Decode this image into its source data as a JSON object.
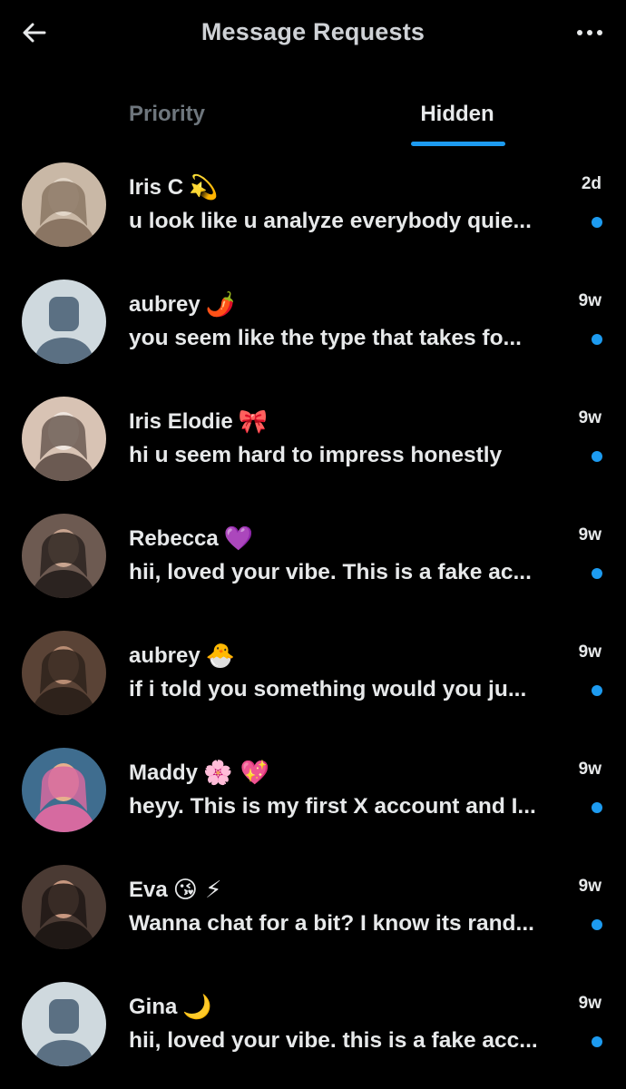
{
  "header": {
    "title": "Message Requests",
    "back_icon": "arrow-left-icon",
    "more_icon": "ellipsis-icon"
  },
  "tabs": [
    {
      "label": "Priority",
      "active": false
    },
    {
      "label": "Hidden",
      "active": true
    }
  ],
  "colors": {
    "background": "#000000",
    "accent": "#1d9bf0",
    "text": "#e7e9ea",
    "muted": "#6e767d"
  },
  "requests": [
    {
      "name": "Iris C",
      "emoji": "💫",
      "time": "2d",
      "preview": "u look like u analyze everybody quie...",
      "unread": true,
      "avatar": "photo"
    },
    {
      "name": "aubrey",
      "emoji": "🌶️",
      "time": "9w",
      "preview": "you seem like the type that takes fo...",
      "unread": true,
      "avatar": "default"
    },
    {
      "name": "Iris Elodie",
      "emoji": "🎀",
      "time": "9w",
      "preview": "hi u seem hard to impress honestly",
      "unread": true,
      "avatar": "photo"
    },
    {
      "name": "Rebecca",
      "emoji": "💜",
      "time": "9w",
      "preview": "hii, loved your vibe. This is a fake ac...",
      "unread": true,
      "avatar": "photo"
    },
    {
      "name": "aubrey",
      "emoji": "🐣",
      "time": "9w",
      "preview": "if i told you something would you ju...",
      "unread": true,
      "avatar": "photo"
    },
    {
      "name": "Maddy",
      "emoji": "🌸 💖",
      "time": "9w",
      "preview": "heyy. This is my first X account and I...",
      "unread": true,
      "avatar": "photo"
    },
    {
      "name": "Eva",
      "emoji": "😘 ⚡",
      "time": "9w",
      "preview": "Wanna chat for a bit? I know its rand...",
      "unread": true,
      "avatar": "photo"
    },
    {
      "name": "Gina",
      "emoji": "🌙",
      "time": "9w",
      "preview": "hii, loved your vibe. this is a fake acc...",
      "unread": true,
      "avatar": "default"
    }
  ]
}
